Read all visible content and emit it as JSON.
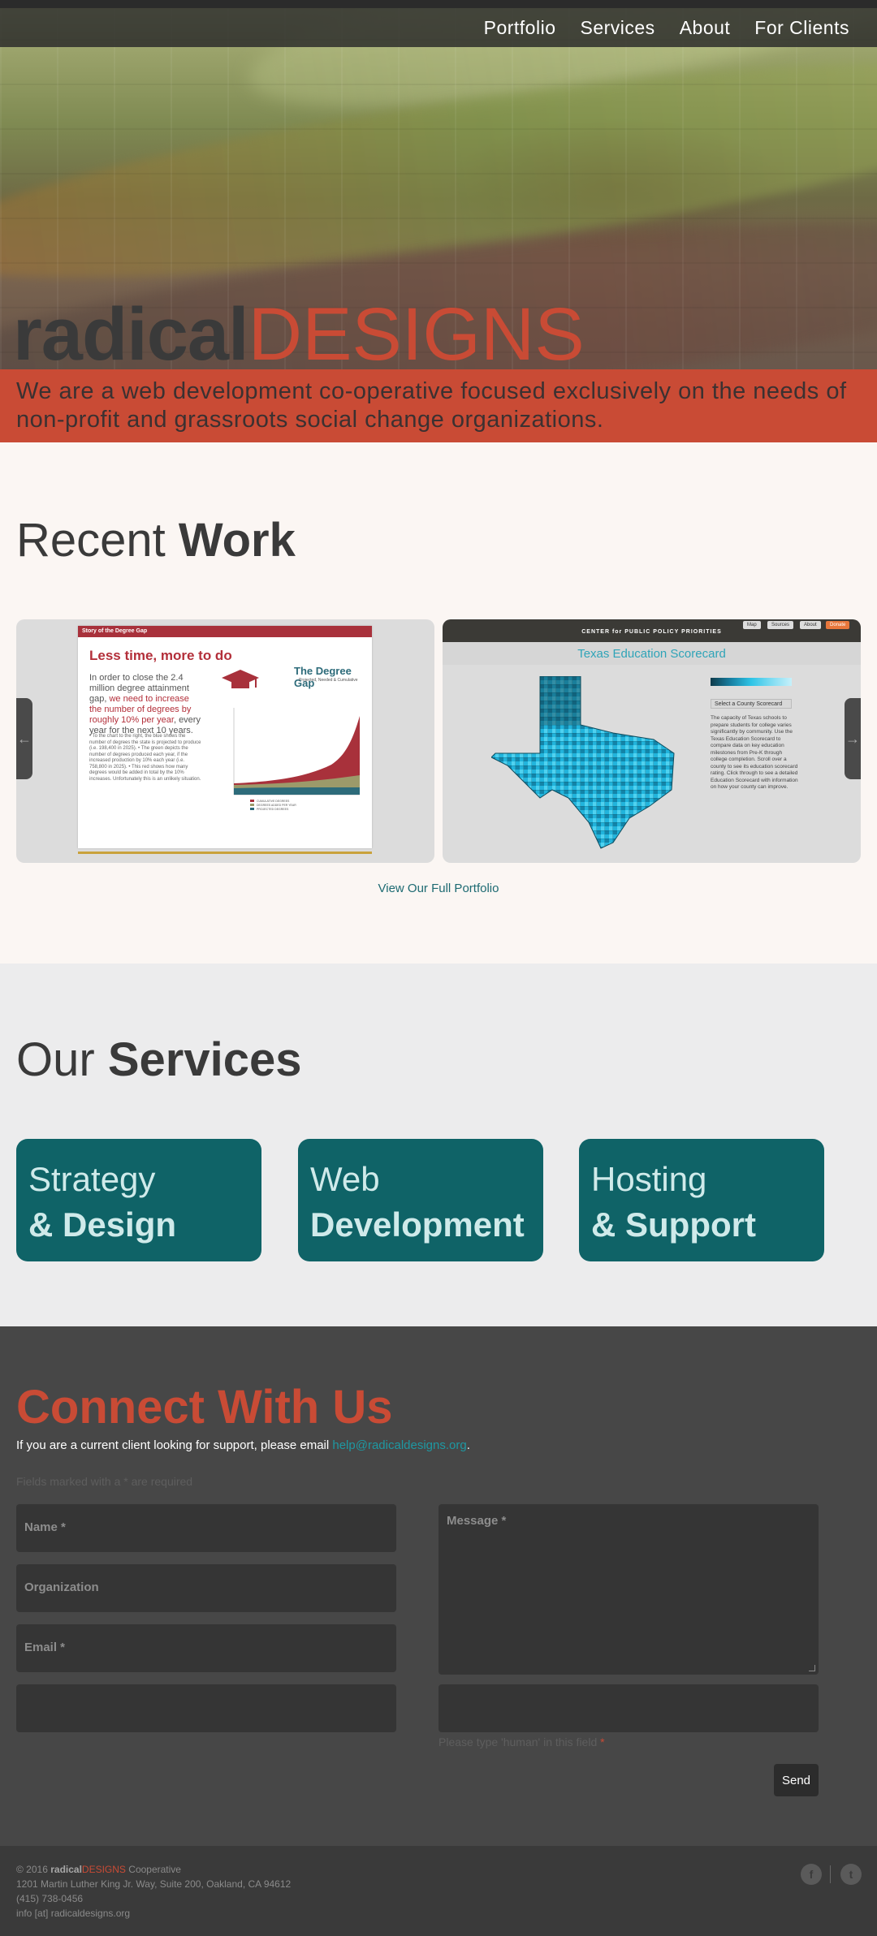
{
  "nav": {
    "items": [
      {
        "label": "Portfolio"
      },
      {
        "label": "Services"
      },
      {
        "label": "About"
      },
      {
        "label": "For Clients"
      }
    ]
  },
  "hero": {
    "logo_part1": "radical",
    "logo_part2": "DESIGNS",
    "tagline": "We are a web development co-operative focused exclusively on the needs of non-profit and grassroots social change organizations."
  },
  "recent_work": {
    "title_light": "Recent ",
    "title_bold": "Work",
    "slide1": {
      "header": "Story of the Degree Gap",
      "title": "Less time, more to do",
      "intro_a": "In order to close the 2.4 million degree attainment gap, ",
      "intro_b": "we need to increase the number of degrees by roughly 10% per year",
      "intro_c": ", every year for the next 10 years.",
      "bullets": "• To the chart to the right, the blue shows the number of degrees the state is projected to produce (i.e. 198,400 in 2025). • The green depicts the number of degrees produced each year, if the increased production by 10% each year (i.e. 758,800 in 2025). • This red shows how many degrees would be added in total by the 10% increases. Unfortunately this is an unlikely situation.",
      "chart_title": "The Degree Gap",
      "chart_sub": "Projected, Needed & Cumulative",
      "legend": [
        "CUMULATIVE DEGREES",
        "DEGREES ADDED PER YEAR",
        "PROJECTED DEGREES"
      ]
    },
    "slide2": {
      "brand": "CENTER for PUBLIC POLICY PRIORITIES",
      "buttons": [
        "Map",
        "Sources",
        "About",
        "Donate"
      ],
      "title": "Texas Education Scorecard",
      "select": "Select a County Scorecard",
      "text": "The capacity of Texas schools to prepare students for college varies significantly by community. Use the Texas Education Scorecard to compare data on key education milestones from Pre-K through college completion. Scroll over a county to see its education scorecard rating. Click through to see a detailed Education Scorecard with information on how your county can improve."
    },
    "portfolio_link": "View Our Full Portfolio"
  },
  "services": {
    "title_light": "Our ",
    "title_bold": "Services",
    "items": [
      {
        "line1": "Strategy",
        "line2": "& Design"
      },
      {
        "line1": "Web",
        "line2": "Development"
      },
      {
        "line1": "Hosting",
        "line2": "& Support"
      }
    ]
  },
  "connect": {
    "title_light": "Connect ",
    "title_bold": "With Us",
    "intro": "If you are a current client looking for support, please email ",
    "email": "help@radicaldesigns.org",
    "intro_end": ".",
    "required_note": "Fields marked with a * are required",
    "fields": {
      "name": "Name *",
      "organization": "Organization",
      "email": "Email *",
      "message": "Message *"
    },
    "human_note": "Please type 'human' in this field ",
    "human_star": "*",
    "send": "Send"
  },
  "footer": {
    "copyright": "© 2016 ",
    "brand_a": "radical",
    "brand_b": "DESIGNS",
    "coop": " Cooperative",
    "address": "1201 Martin Luther King Jr. Way, Suite 200, Oakland, CA 94612",
    "phone": "(415) 738-0456",
    "email": "info [at] radicaldesigns.org",
    "social": {
      "facebook_icon": "f",
      "twitter_icon": "t"
    }
  },
  "colors": {
    "accent": "#c94b35",
    "service_tile": "#0f6367",
    "link": "#1d6a72",
    "dark_bg": "#474747"
  }
}
